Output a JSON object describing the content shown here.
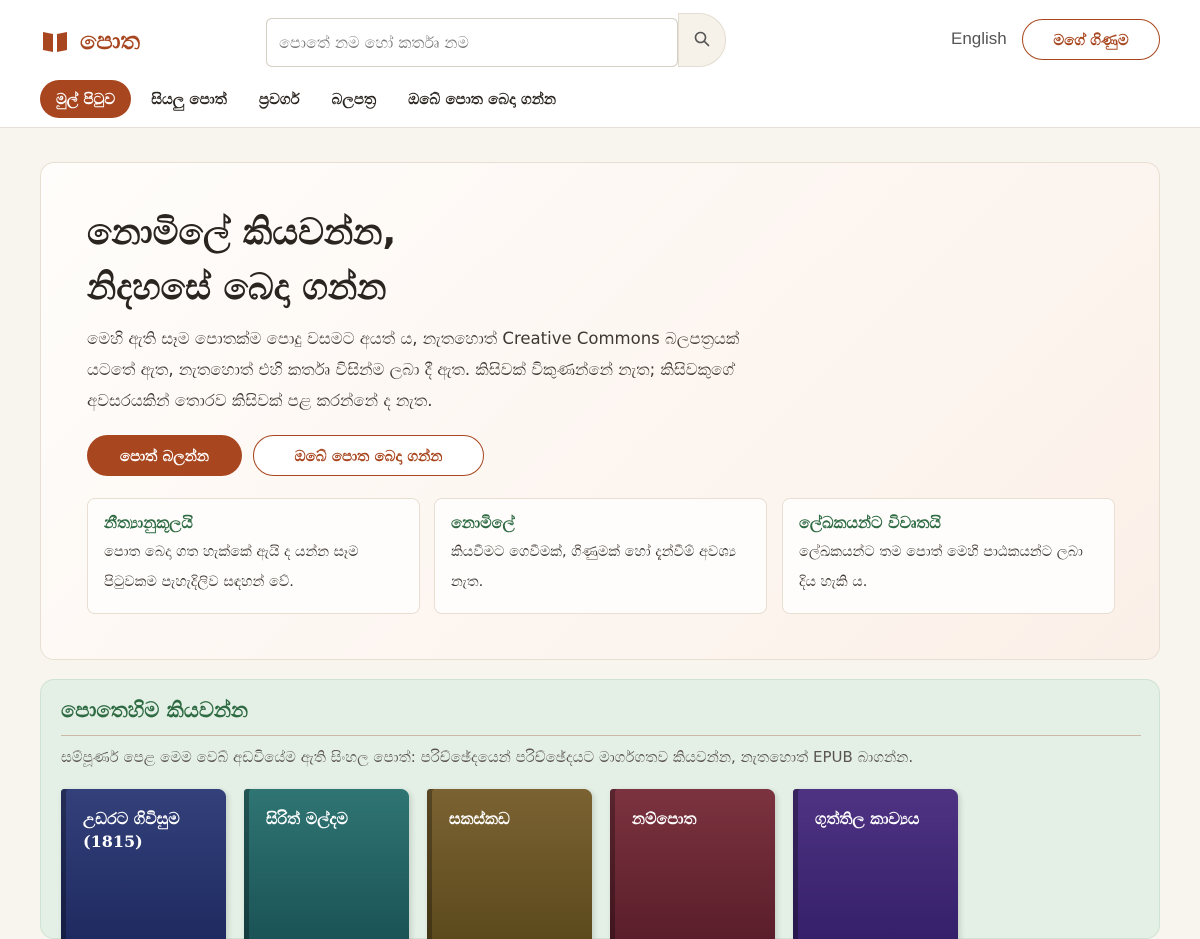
{
  "header": {
    "logo_text": "පොත",
    "search_placeholder": "පොතේ නම හෝ කර්තෘ නම",
    "language_link": "English",
    "account_button": "මගේ ගිණුම"
  },
  "nav": {
    "items": [
      {
        "label": "මුල් පිටුව"
      },
      {
        "label": "සියලු පොත්"
      },
      {
        "label": "ප්‍රවර්ග"
      },
      {
        "label": "බලපත්‍ර"
      },
      {
        "label": "ඔබේ පොත බෙදා ගන්න"
      }
    ]
  },
  "hero": {
    "title_line1": "නොමිලේ කියවන්න,",
    "title_line2": "නිදහසේ බෙදා ගන්න",
    "description": "මෙහි ඇති සෑම පොතක්ම පොදු වසමට අයත් ය, නැතහොත් Creative Commons බලපත්‍රයක් යටතේ ඇත, නැතහොත් එහි කර්තෘ විසින්ම ලබා දී ඇත. කිසිවක් විකුණන්නේ නැත; කිසිවකුගේ අවසරයකින් තොරව කිසිවක් පළ කරන්නේ ද නැත.",
    "primary_button": "පොත් බලන්න",
    "secondary_button": "ඔබේ පොත බෙදා ගන්න",
    "features": [
      {
        "title": "නීත්‍යානුකූලයි",
        "text": "පොත බෙදා ගත හැක්කේ ඇයි ද යන්න සෑම පිටුවකම පැහැදිලිව සඳහන් වේ."
      },
      {
        "title": "නොමිලේ",
        "text": "කියවීමට ගෙවීමක්, ගිණුමක් හෝ දැන්වීම් අවශ්‍ය නැත."
      },
      {
        "title": "ලේඛකයන්ට විවෘතයි",
        "text": "ලේඛකයන්ට තම පොත් මෙහි පාඨකයන්ට ලබා දිය හැකි ය."
      }
    ]
  },
  "read_here": {
    "title": "පොතෙහිම කියවන්න",
    "description": "සම්පූර්ණ පෙළ මෙම වෙබ් අඩවියේම ඇති සිංහල පොත්: පරිච්ඡේදයෙන් පරිච්ඡේදයට මාර්ගගතව කියවන්න, නැතහොත් EPUB බාගන්න.",
    "books": [
      {
        "title": "උඩරට ගිවිසුම (1815)",
        "color_top": "#34407a",
        "color_bottom": "#1e2a60"
      },
      {
        "title": "සිරිත් මල්දම",
        "color_top": "#2f7573",
        "color_bottom": "#1b5356"
      },
      {
        "title": "සකස්කඩ",
        "color_top": "#7b6232",
        "color_bottom": "#5c4a1d"
      },
      {
        "title": "නම්පොත",
        "color_top": "#7c3340",
        "color_bottom": "#5a1e2a"
      },
      {
        "title": "ගුත්තිල කාව්‍යය",
        "color_top": "#4e3383",
        "color_bottom": "#36206a"
      }
    ]
  },
  "colors": {
    "accent": "#a8461f",
    "green": "#2e6b43",
    "page_background": "#f8f5ee"
  }
}
